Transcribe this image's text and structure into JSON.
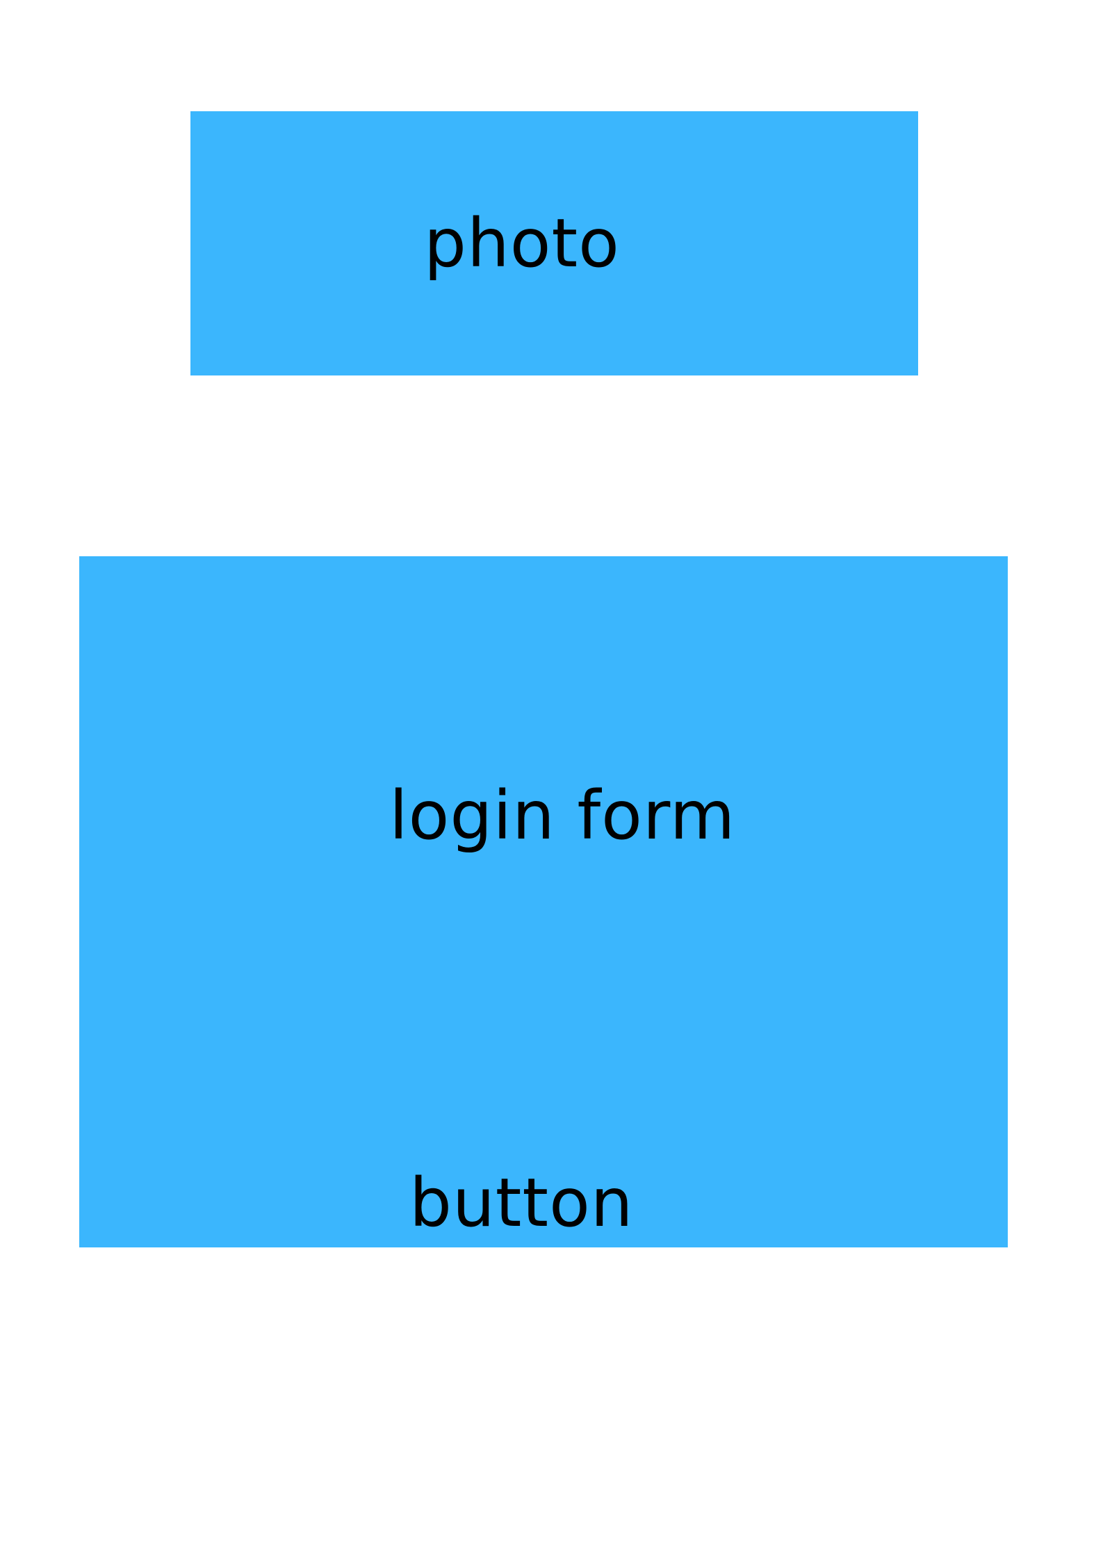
{
  "photo": {
    "label": "photo"
  },
  "login_form": {
    "label": "login form",
    "button": {
      "label": "button"
    }
  },
  "colors": {
    "block_fill": "#3bb6fd",
    "text": "#000000",
    "background": "#ffffff"
  }
}
